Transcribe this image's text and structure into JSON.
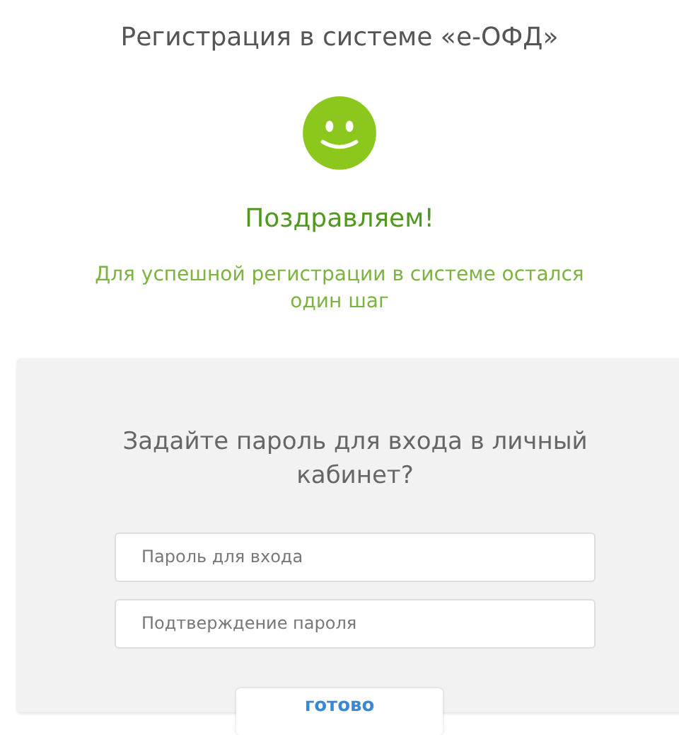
{
  "page_title": "Регистрация в системе «е-ОФД»",
  "heading": "Поздравляем!",
  "subtitle": "Для успешной регистрации в системе остался один шаг",
  "form": {
    "question": "Задайте пароль для входа в личный кабинет?",
    "fields": [
      {
        "placeholder": "Пароль для входа"
      },
      {
        "placeholder": "Подтверждение пароля"
      }
    ],
    "submit": "готово"
  }
}
